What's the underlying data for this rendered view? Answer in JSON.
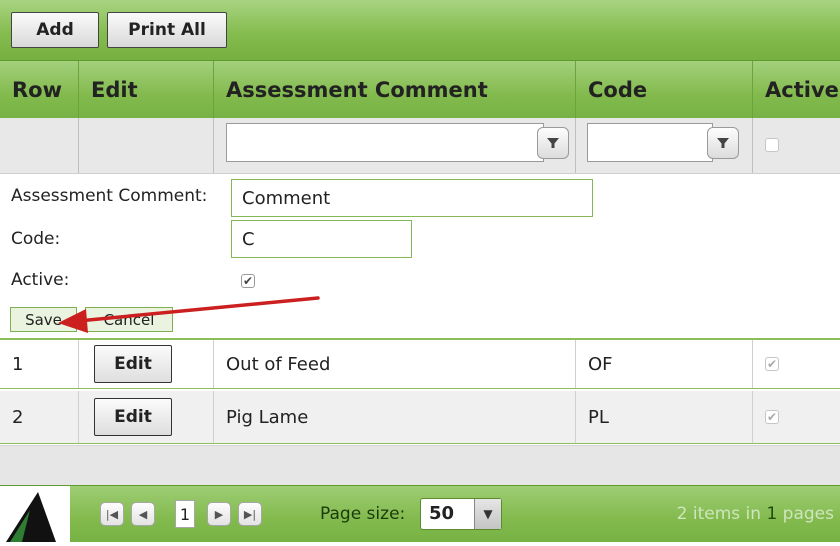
{
  "toolbar": {
    "add_label": "Add",
    "print_label": "Print All"
  },
  "columns": {
    "row": "Row",
    "edit": "Edit",
    "comment": "Assessment Comment",
    "code": "Code",
    "active": "Active"
  },
  "filter": {
    "comment_value": "",
    "code_value": "",
    "filter_icon": "filter-icon"
  },
  "form": {
    "comment_label": "Assessment Comment:",
    "comment_value": "Comment",
    "code_label": "Code:",
    "code_value": "C",
    "active_label": "Active:",
    "active_checked": true,
    "save_label": "Save",
    "cancel_label": "Cancel"
  },
  "rows": [
    {
      "row": "1",
      "edit_label": "Edit",
      "comment": "Out of Feed",
      "code": "OF",
      "active": true
    },
    {
      "row": "2",
      "edit_label": "Edit",
      "comment": "Pig Lame",
      "code": "PL",
      "active": true
    }
  ],
  "pager": {
    "current_page": "1",
    "page_size_label": "Page size:",
    "page_size_value": "50",
    "status_count": "2",
    "status_mid": "items in",
    "status_pages": "1",
    "status_end": "pages"
  },
  "colors": {
    "accent": "#82ba4d",
    "arrow": "#cc1f1f"
  }
}
